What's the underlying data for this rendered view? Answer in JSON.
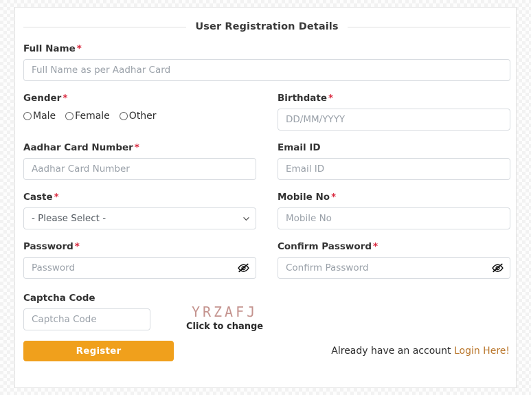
{
  "header": {
    "title": "User Registration Details"
  },
  "fields": {
    "full_name": {
      "label": "Full Name",
      "required": true,
      "placeholder": "Full Name as per Aadhar Card",
      "value": ""
    },
    "gender": {
      "label": "Gender",
      "required": true,
      "options": [
        {
          "label": "Male",
          "selected": false
        },
        {
          "label": "Female",
          "selected": false
        },
        {
          "label": "Other",
          "selected": false
        }
      ]
    },
    "birthdate": {
      "label": "Birthdate",
      "required": true,
      "placeholder": "DD/MM/YYYY",
      "value": ""
    },
    "aadhar": {
      "label": "Aadhar Card Number",
      "required": true,
      "placeholder": "Aadhar Card Number",
      "value": ""
    },
    "email": {
      "label": "Email ID",
      "required": false,
      "placeholder": "Email ID",
      "value": ""
    },
    "caste": {
      "label": "Caste",
      "required": true,
      "selected_option": "- Please Select -",
      "icon": "chevron-down-icon"
    },
    "mobile": {
      "label": "Mobile No",
      "required": true,
      "placeholder": "Mobile No",
      "value": ""
    },
    "password": {
      "label": "Password",
      "required": true,
      "placeholder": "Password",
      "value": "",
      "toggle_icon": "eye-slash-icon"
    },
    "confirm_password": {
      "label": "Confirm Password",
      "required": true,
      "placeholder": "Confirm Password",
      "value": "",
      "toggle_icon": "eye-slash-icon"
    },
    "captcha": {
      "label": "Captcha Code",
      "required": false,
      "placeholder": "Captcha Code",
      "value": "",
      "image_text": "YRZAFJ",
      "refresh_hint": "Click to change"
    }
  },
  "footer": {
    "register_label": "Register",
    "account_note": "Already have an account",
    "login_link": "Login Here!"
  },
  "colors": {
    "required_asterisk": "#d9293f",
    "register_button": "#f0a01c",
    "login_link": "#b9762b",
    "captcha_text": "#c4938e",
    "input_border": "#d7dbe0",
    "placeholder": "#9aa1a9"
  }
}
